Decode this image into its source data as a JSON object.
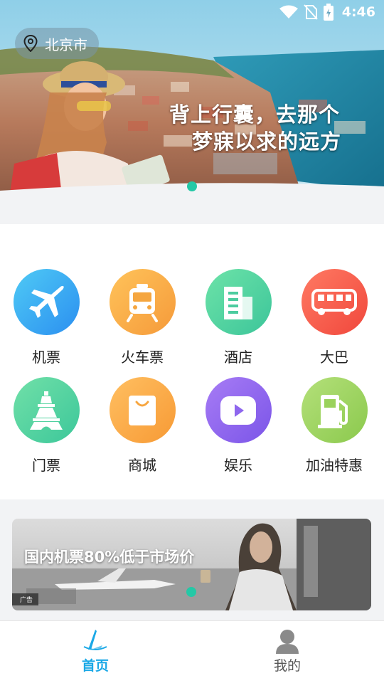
{
  "status_bar": {
    "time": "4:46"
  },
  "location": {
    "city": "北京市"
  },
  "hero": {
    "slogan_line1": "背上行囊，去那个",
    "slogan_line2": "梦寐以求的远方"
  },
  "categories": [
    {
      "label": "机票",
      "icon": "airplane-icon",
      "color_from": "#4fcaf5",
      "color_to": "#2b8ff0"
    },
    {
      "label": "火车票",
      "icon": "train-icon",
      "color_from": "#ffc35a",
      "color_to": "#f59a3a"
    },
    {
      "label": "酒店",
      "icon": "hotel-icon",
      "color_from": "#6de3a8",
      "color_to": "#3cc59a"
    },
    {
      "label": "大巴",
      "icon": "bus-icon",
      "color_from": "#ff7a63",
      "color_to": "#f0473c"
    },
    {
      "label": "门票",
      "icon": "tower-icon",
      "color_from": "#71e0a8",
      "color_to": "#3cc79a"
    },
    {
      "label": "商城",
      "icon": "shopping-bag-icon",
      "color_from": "#ffbf61",
      "color_to": "#f79a35"
    },
    {
      "label": "娱乐",
      "icon": "play-icon",
      "color_from": "#a77cf5",
      "color_to": "#7b55e8"
    },
    {
      "label": "加油特惠",
      "icon": "fuel-pump-icon",
      "color_from": "#b4e07a",
      "color_to": "#8bc94d"
    }
  ],
  "ad": {
    "text": "国内机票80%低于市场价",
    "tag": "广告"
  },
  "bottom_nav": {
    "items": [
      {
        "label": "首页",
        "icon": "home-logo-icon",
        "active": true
      },
      {
        "label": "我的",
        "icon": "profile-icon",
        "active": false
      }
    ]
  },
  "colors": {
    "accent": "#1aa8e6",
    "indicator": "#24c8a6"
  }
}
